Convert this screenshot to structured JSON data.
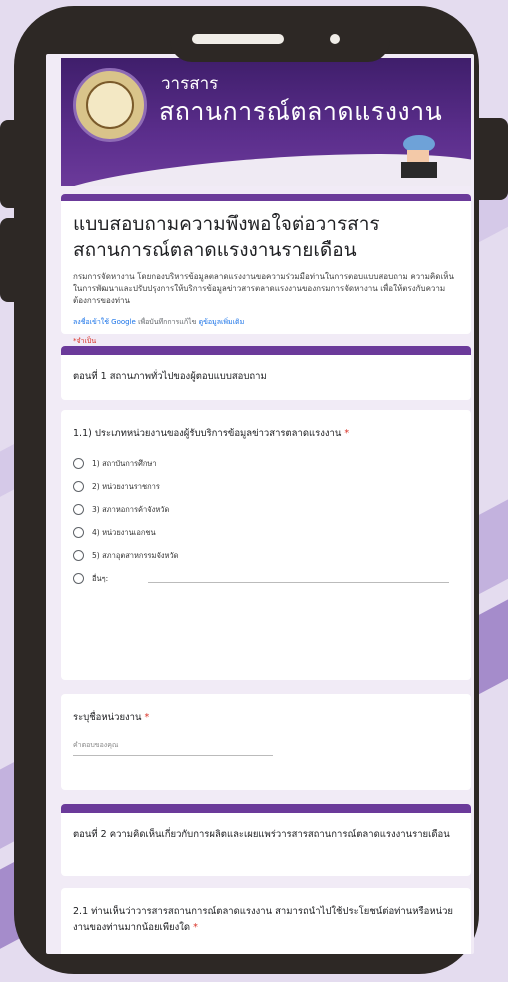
{
  "banner": {
    "small_title": "วารสาร",
    "big_title": "สถานการณ์ตลาดแรงงาน"
  },
  "form": {
    "title": "แบบสอบถามความพึงพอใจต่อวารสารสถานการณ์ตลาดแรงงานรายเดือน",
    "description": "กรมการจัดหางาน โดยกองบริหารข้อมูลตลาดแรงงานขอความร่วมมือท่านในการตอบแบบสอบถาม ความคิดเห็นในการพัฒนาและปรับปรุงการให้บริการข้อมูลข่าวสารตลาดแรงงานของกรมการจัดหางาน เพื่อให้ตรงกับความต้องการของท่าน",
    "signin_link": "ลงชื่อเข้าใช้ Google",
    "signin_mid": " เพื่อบันทึกการแก้ไข ",
    "signin_more": "ดูข้อมูลเพิ่มเติม",
    "required_note": "*จำเป็น"
  },
  "section1": {
    "title": "ตอนที่ 1 สถานภาพทั่วไปของผู้ตอบแบบสอบถาม"
  },
  "q1": {
    "label": "1.1) ประเภทหน่วยงานของผู้รับบริการข้อมูลข่าวสารตลาดแรงงาน",
    "required": "*",
    "options": [
      "1) สถาบันการศึกษา",
      "2) หน่วยงานราชการ",
      "3) สภาหอการค้าจังหวัด",
      "4) หน่วยงานเอกชน",
      "5) สภาอุตสาหกรรมจังหวัด",
      "อื่นๆ:"
    ]
  },
  "q2": {
    "label": "ระบุชื่อหน่วยงาน",
    "required": "*",
    "placeholder": "คำตอบของคุณ"
  },
  "section2": {
    "title": "ตอนที่ 2 ความคิดเห็นเกี่ยวกับการผลิตและเผยแพร่วารสารสถานการณ์ตลาดแรงงานรายเดือน"
  },
  "q3": {
    "label": "2.1 ท่านเห็นว่าวารสารสถานการณ์ตลาดแรงงาน สามารถนำไปใช้ประโยชน์ต่อท่านหรือหน่วยงานของท่านมากน้อยเพียงใด",
    "required": "*"
  },
  "colors": {
    "accent": "#6b3a9a",
    "phone": "#2d2825",
    "background": "#e4dcef"
  }
}
